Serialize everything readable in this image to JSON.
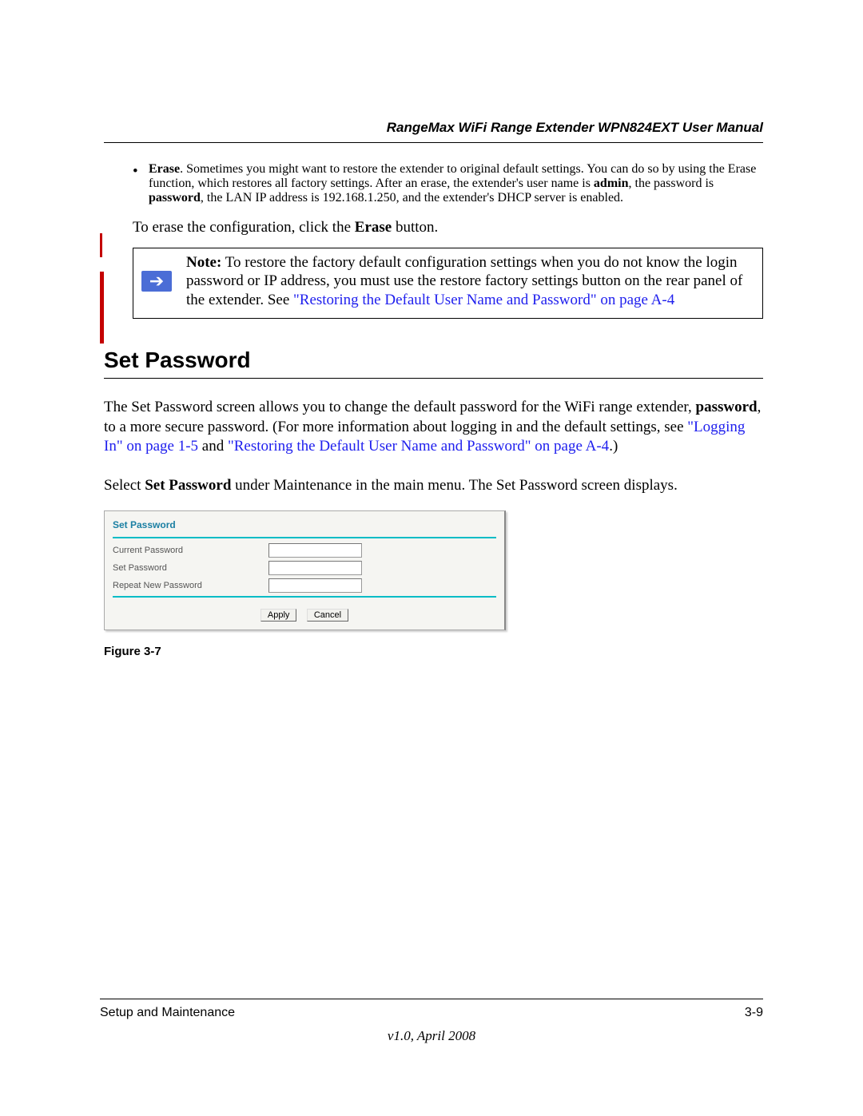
{
  "header": {
    "title": "RangeMax WiFi Range Extender WPN824EXT User Manual"
  },
  "erase_bullet": {
    "label": "Erase",
    "text_after_label": ". Sometimes you might want to restore the extender to original default settings. You can do so by using the Erase function, which restores all factory settings. After an erase, the extender's user name is ",
    "admin": "admin",
    "mid1": ", the password is ",
    "password": "password",
    "mid2": ", the LAN IP address is 192.168.1.250, and the extender's DHCP server is enabled."
  },
  "erase_line": {
    "pre": "To erase the configuration, click the ",
    "bold": "Erase",
    "post": " button."
  },
  "note": {
    "label": "Note:",
    "text1": " To restore the factory default configuration settings when you do not know the login password or IP address, you must use the restore factory settings button on the rear panel of the extender. See ",
    "link": "\"Restoring the Default User Name and Password\" on page A-4"
  },
  "section_heading": "Set Password",
  "para1": {
    "t1": "The Set Password screen allows you to change the default password for the WiFi range extender, ",
    "b1": "password",
    "t2": ", to a more secure password. (For more information about logging in and the default settings, see ",
    "link1": "\"Logging In\" on page 1-5",
    "t3": " and ",
    "link2": "\"Restoring the Default User Name and Password\" on page A-4",
    "t4": ".)"
  },
  "para2": {
    "t1": "Select ",
    "b1": "Set Password",
    "t2": " under Maintenance in the main menu. The Set Password screen displays."
  },
  "screenshot": {
    "title": "Set Password",
    "row1": "Current Password",
    "row2": "Set Password",
    "row3": "Repeat New Password",
    "apply": "Apply",
    "cancel": "Cancel"
  },
  "figure_label": "Figure 3-7",
  "footer": {
    "left": "Setup and Maintenance",
    "right": "3-9",
    "version": "v1.0, April 2008"
  }
}
